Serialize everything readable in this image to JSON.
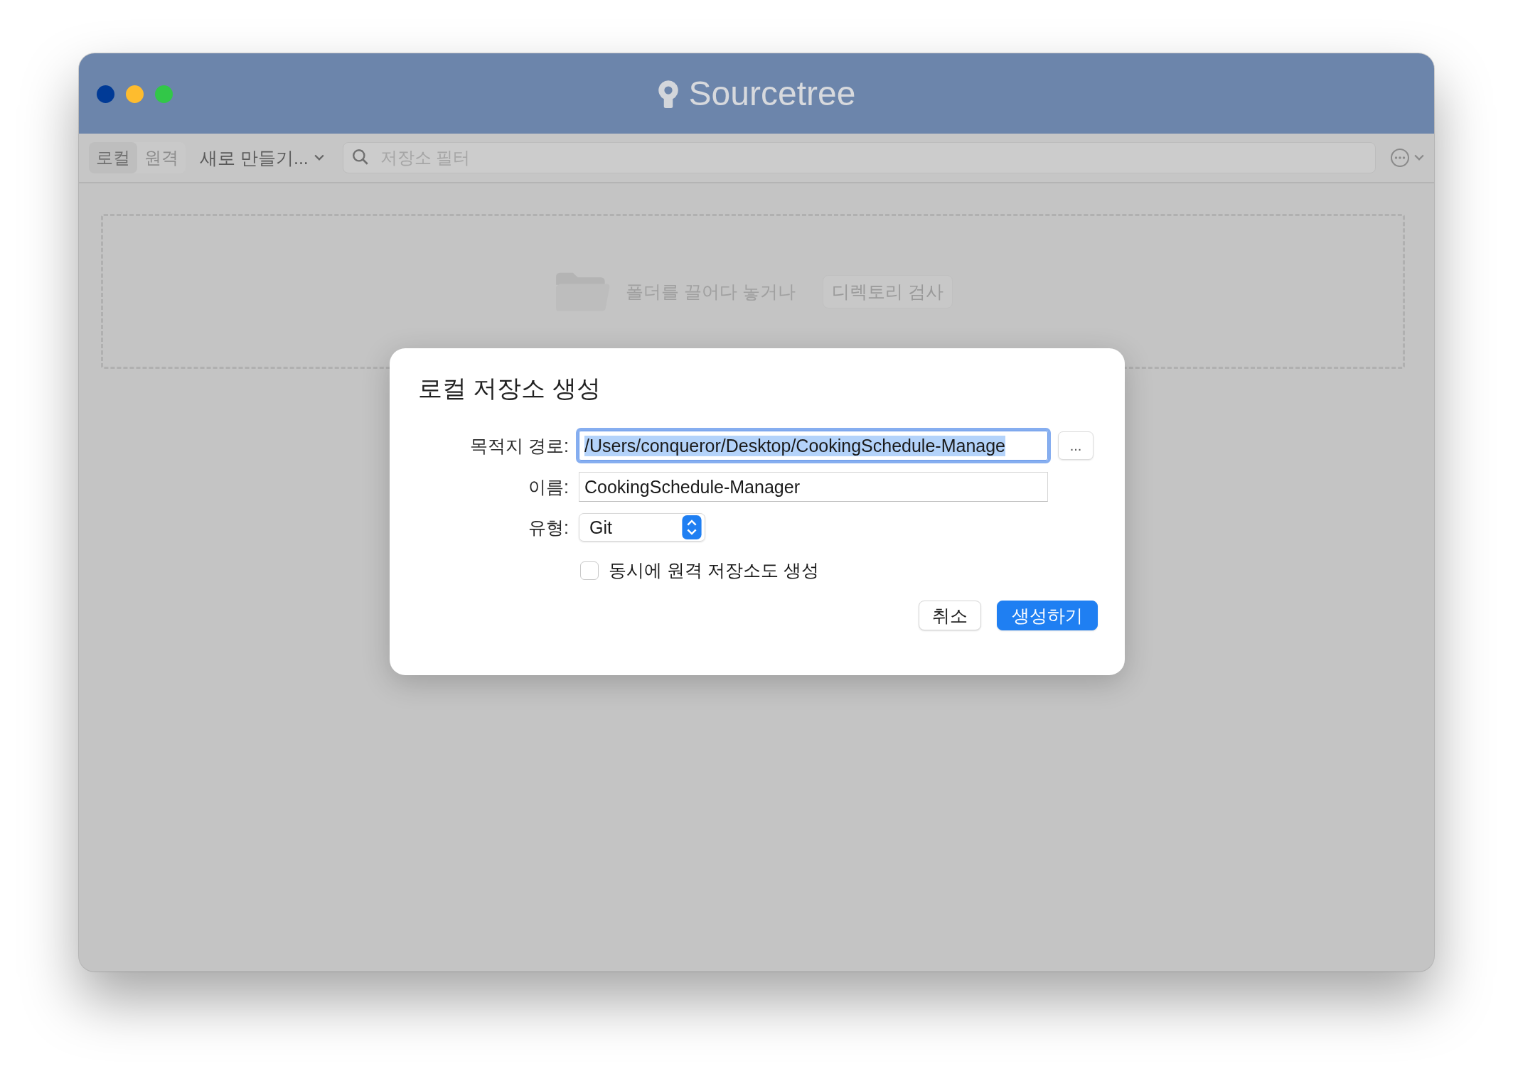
{
  "window": {
    "title": "Sourcetree"
  },
  "toolbar": {
    "tabs": [
      {
        "label": "로컬",
        "selected": true
      },
      {
        "label": "원격",
        "selected": false
      }
    ],
    "new_menu": "새로 만들기...",
    "search": {
      "placeholder": "저장소 필터"
    }
  },
  "drop_zone": {
    "text": "폴더를 끌어다 놓거나",
    "button": "디렉토리 검사"
  },
  "dialog": {
    "title": "로컬 저장소 생성",
    "fields": [
      {
        "kind": "text",
        "label": "목적지 경로:",
        "value": "/Users/conqueror/Desktop/CookingSchedule-Manage",
        "focused": true,
        "browse_button": "..."
      },
      {
        "kind": "text",
        "label": "이름:",
        "value": "CookingSchedule-Manager",
        "focused": false
      },
      {
        "kind": "select",
        "label": "유형:",
        "value": "Git"
      }
    ],
    "checkbox": {
      "label": "동시에 원격 저장소도 생성",
      "checked": false
    },
    "buttons": [
      {
        "label": "취소",
        "default": false
      },
      {
        "label": "생성하기",
        "default": true
      }
    ]
  }
}
